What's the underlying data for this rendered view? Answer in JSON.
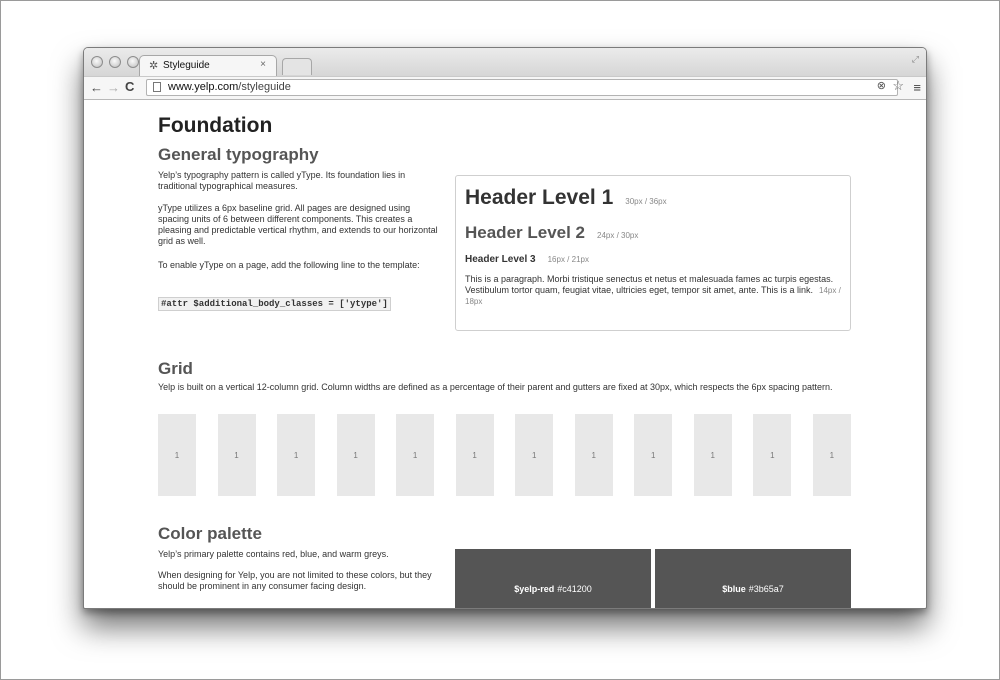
{
  "browser": {
    "tab_title": "Styleguide",
    "tab_icon": "yelp-favicon",
    "tab_close": "×",
    "url_host": "www.yelp.com",
    "url_path": "/styleguide"
  },
  "page": {
    "title": "Foundation",
    "typography": {
      "heading": "General typography",
      "p1": "Yelp’s typography pattern is called yType. Its foundation lies in traditional typographical measures.",
      "p2": "yType utilizes a 6px baseline grid. All pages are designed using spacing units of 6 between different components. This creates a pleasing and predictable vertical rhythm, and extends to our horizontal grid as well.",
      "p3": "To enable yType on a page, add the following line to the template:",
      "code": "#attr $additional_body_classes = ['ytype']",
      "demo": {
        "h1": "Header Level 1",
        "h1_size": "30px / 36px",
        "h2": "Header Level 2",
        "h2_size": "24px / 30px",
        "h3": "Header Level 3",
        "h3_size": "16px / 21px",
        "paragraph": "This is a paragraph. Morbi tristique senectus et netus et malesuada fames ac turpis egestas. Vestibulum tortor quam, feugiat vitae, ultricies eget, tempor sit amet, ante. This is a link.",
        "paragraph_size": "14px / 18px"
      }
    },
    "grid": {
      "heading": "Grid",
      "description": "Yelp is built on a vertical 12-column grid. Column widths are defined as a percentage of their parent and gutters are fixed at 30px, which respects the 6px spacing pattern.",
      "columns": [
        "1",
        "1",
        "1",
        "1",
        "1",
        "1",
        "1",
        "1",
        "1",
        "1",
        "1",
        "1"
      ]
    },
    "palette": {
      "heading": "Color palette",
      "p1": "Yelp’s primary palette contains red, blue, and warm greys.",
      "p2": "When designing for Yelp, you are not limited to these colors, but they should be prominent in any consumer facing design.",
      "swatches": [
        {
          "name": "$yelp-red",
          "hex": "#c41200"
        },
        {
          "name": "$blue",
          "hex": "#3b65a7"
        }
      ]
    }
  }
}
